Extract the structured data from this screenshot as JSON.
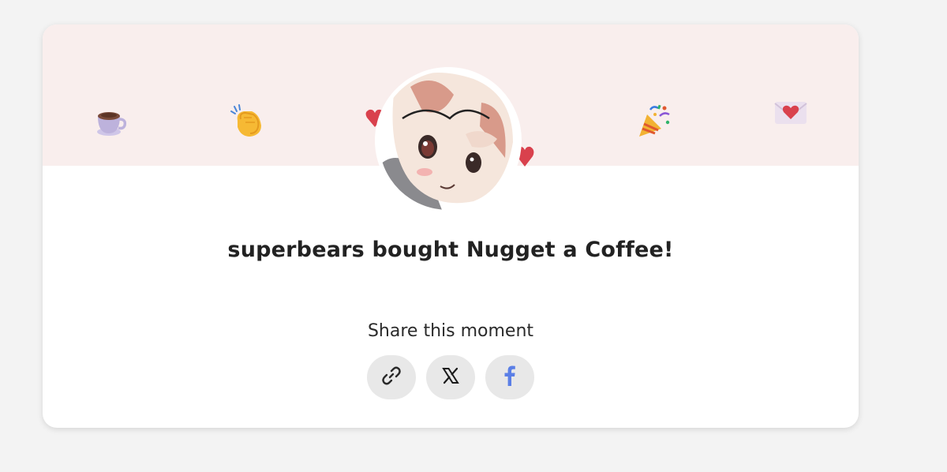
{
  "banner": {
    "background_color": "#f9eeed",
    "emojis": [
      "coffee-cup-icon",
      "clapping-hands-icon",
      "heart-icon",
      "heart-icon",
      "party-popper-icon",
      "love-letter-icon"
    ]
  },
  "supporter": {
    "name": "superbears"
  },
  "creator": {
    "name": "Nugget"
  },
  "message": {
    "title": "superbears bought Nugget a Coffee!"
  },
  "share": {
    "label": "Share this moment",
    "buttons": [
      "copy-link",
      "x",
      "facebook"
    ],
    "facebook_color": "#5b7fe6"
  }
}
